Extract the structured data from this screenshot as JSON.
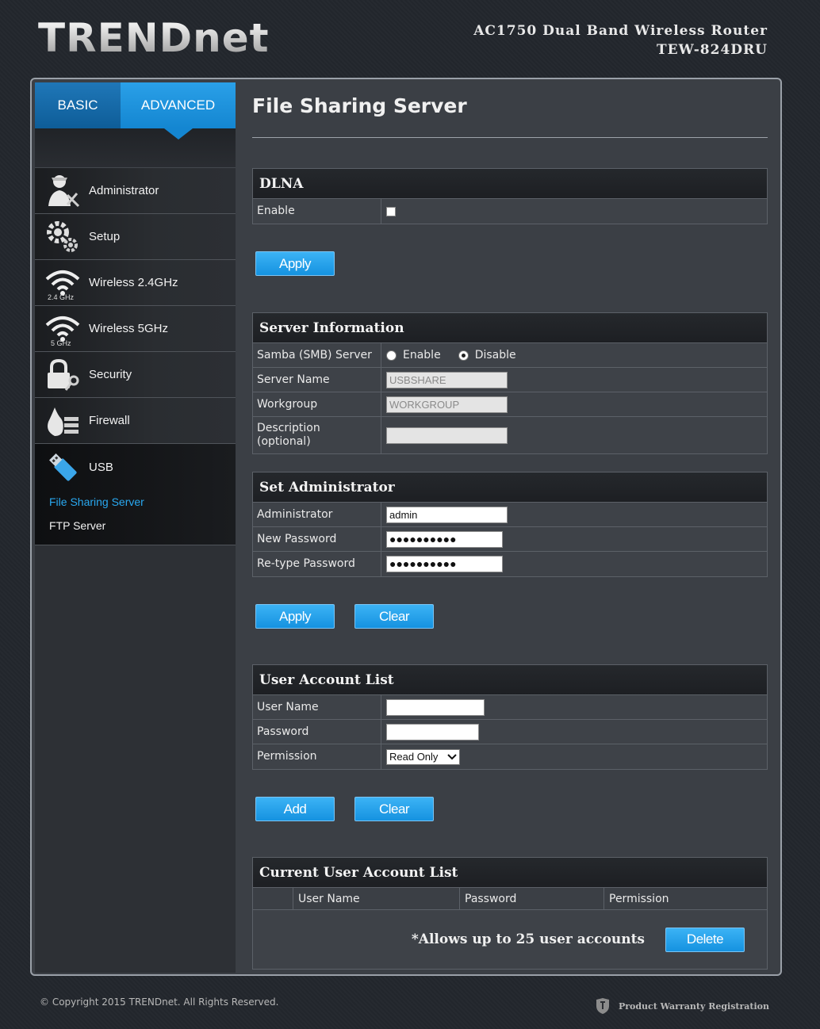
{
  "header": {
    "logo": "TRENDnet",
    "product_line1": "AC1750 Dual Band Wireless Router",
    "product_line2": "TEW-824DRU"
  },
  "tabs": {
    "basic": "BASIC",
    "advanced": "ADVANCED"
  },
  "sidebar": {
    "items": [
      {
        "label": "Administrator",
        "icon": "administrator-icon"
      },
      {
        "label": "Setup",
        "icon": "gear-icon"
      },
      {
        "label": "Wireless 2.4GHz",
        "icon": "wifi-icon",
        "sub": "2.4 GHz"
      },
      {
        "label": "Wireless 5GHz",
        "icon": "wifi-icon",
        "sub": "5 GHz"
      },
      {
        "label": "Security",
        "icon": "lock-icon"
      },
      {
        "label": "Firewall",
        "icon": "firewall-icon"
      },
      {
        "label": "USB",
        "icon": "usb-icon"
      }
    ],
    "usb_sub": [
      "File Sharing Server",
      "FTP Server"
    ]
  },
  "page": {
    "title": "File Sharing Server",
    "dlna": {
      "title": "DLNA",
      "enable_label": "Enable",
      "apply": "Apply"
    },
    "server_info": {
      "title": "Server Information",
      "samba_label": "Samba (SMB) Server",
      "enable_option": "Enable",
      "disable_option": "Disable",
      "server_name_label": "Server Name",
      "server_name_value": "USBSHARE",
      "workgroup_label": "Workgroup",
      "workgroup_value": "WORKGROUP",
      "description_label": "Description (optional)",
      "description_value": ""
    },
    "set_admin": {
      "title": "Set Administrator",
      "admin_label": "Administrator",
      "admin_value": "admin",
      "new_pwd_label": "New Password",
      "new_pwd_value": "●●●●●●●●●●",
      "retype_label": "Re-type Password",
      "retype_value": "●●●●●●●●●●",
      "apply": "Apply",
      "clear": "Clear"
    },
    "user_account": {
      "title": "User Account List",
      "username_label": "User Name",
      "password_label": "Password",
      "permission_label": "Permission",
      "permission_value": "Read Only",
      "add": "Add",
      "clear": "Clear"
    },
    "current_list": {
      "title": "Current User Account List",
      "columns": [
        "",
        "User Name",
        "Password",
        "Permission"
      ],
      "note": "*Allows up to 25 user accounts",
      "delete": "Delete"
    }
  },
  "footer": {
    "copyright": "© Copyright 2015 TRENDnet. All Rights Reserved.",
    "warranty": "Product Warranty Registration"
  }
}
